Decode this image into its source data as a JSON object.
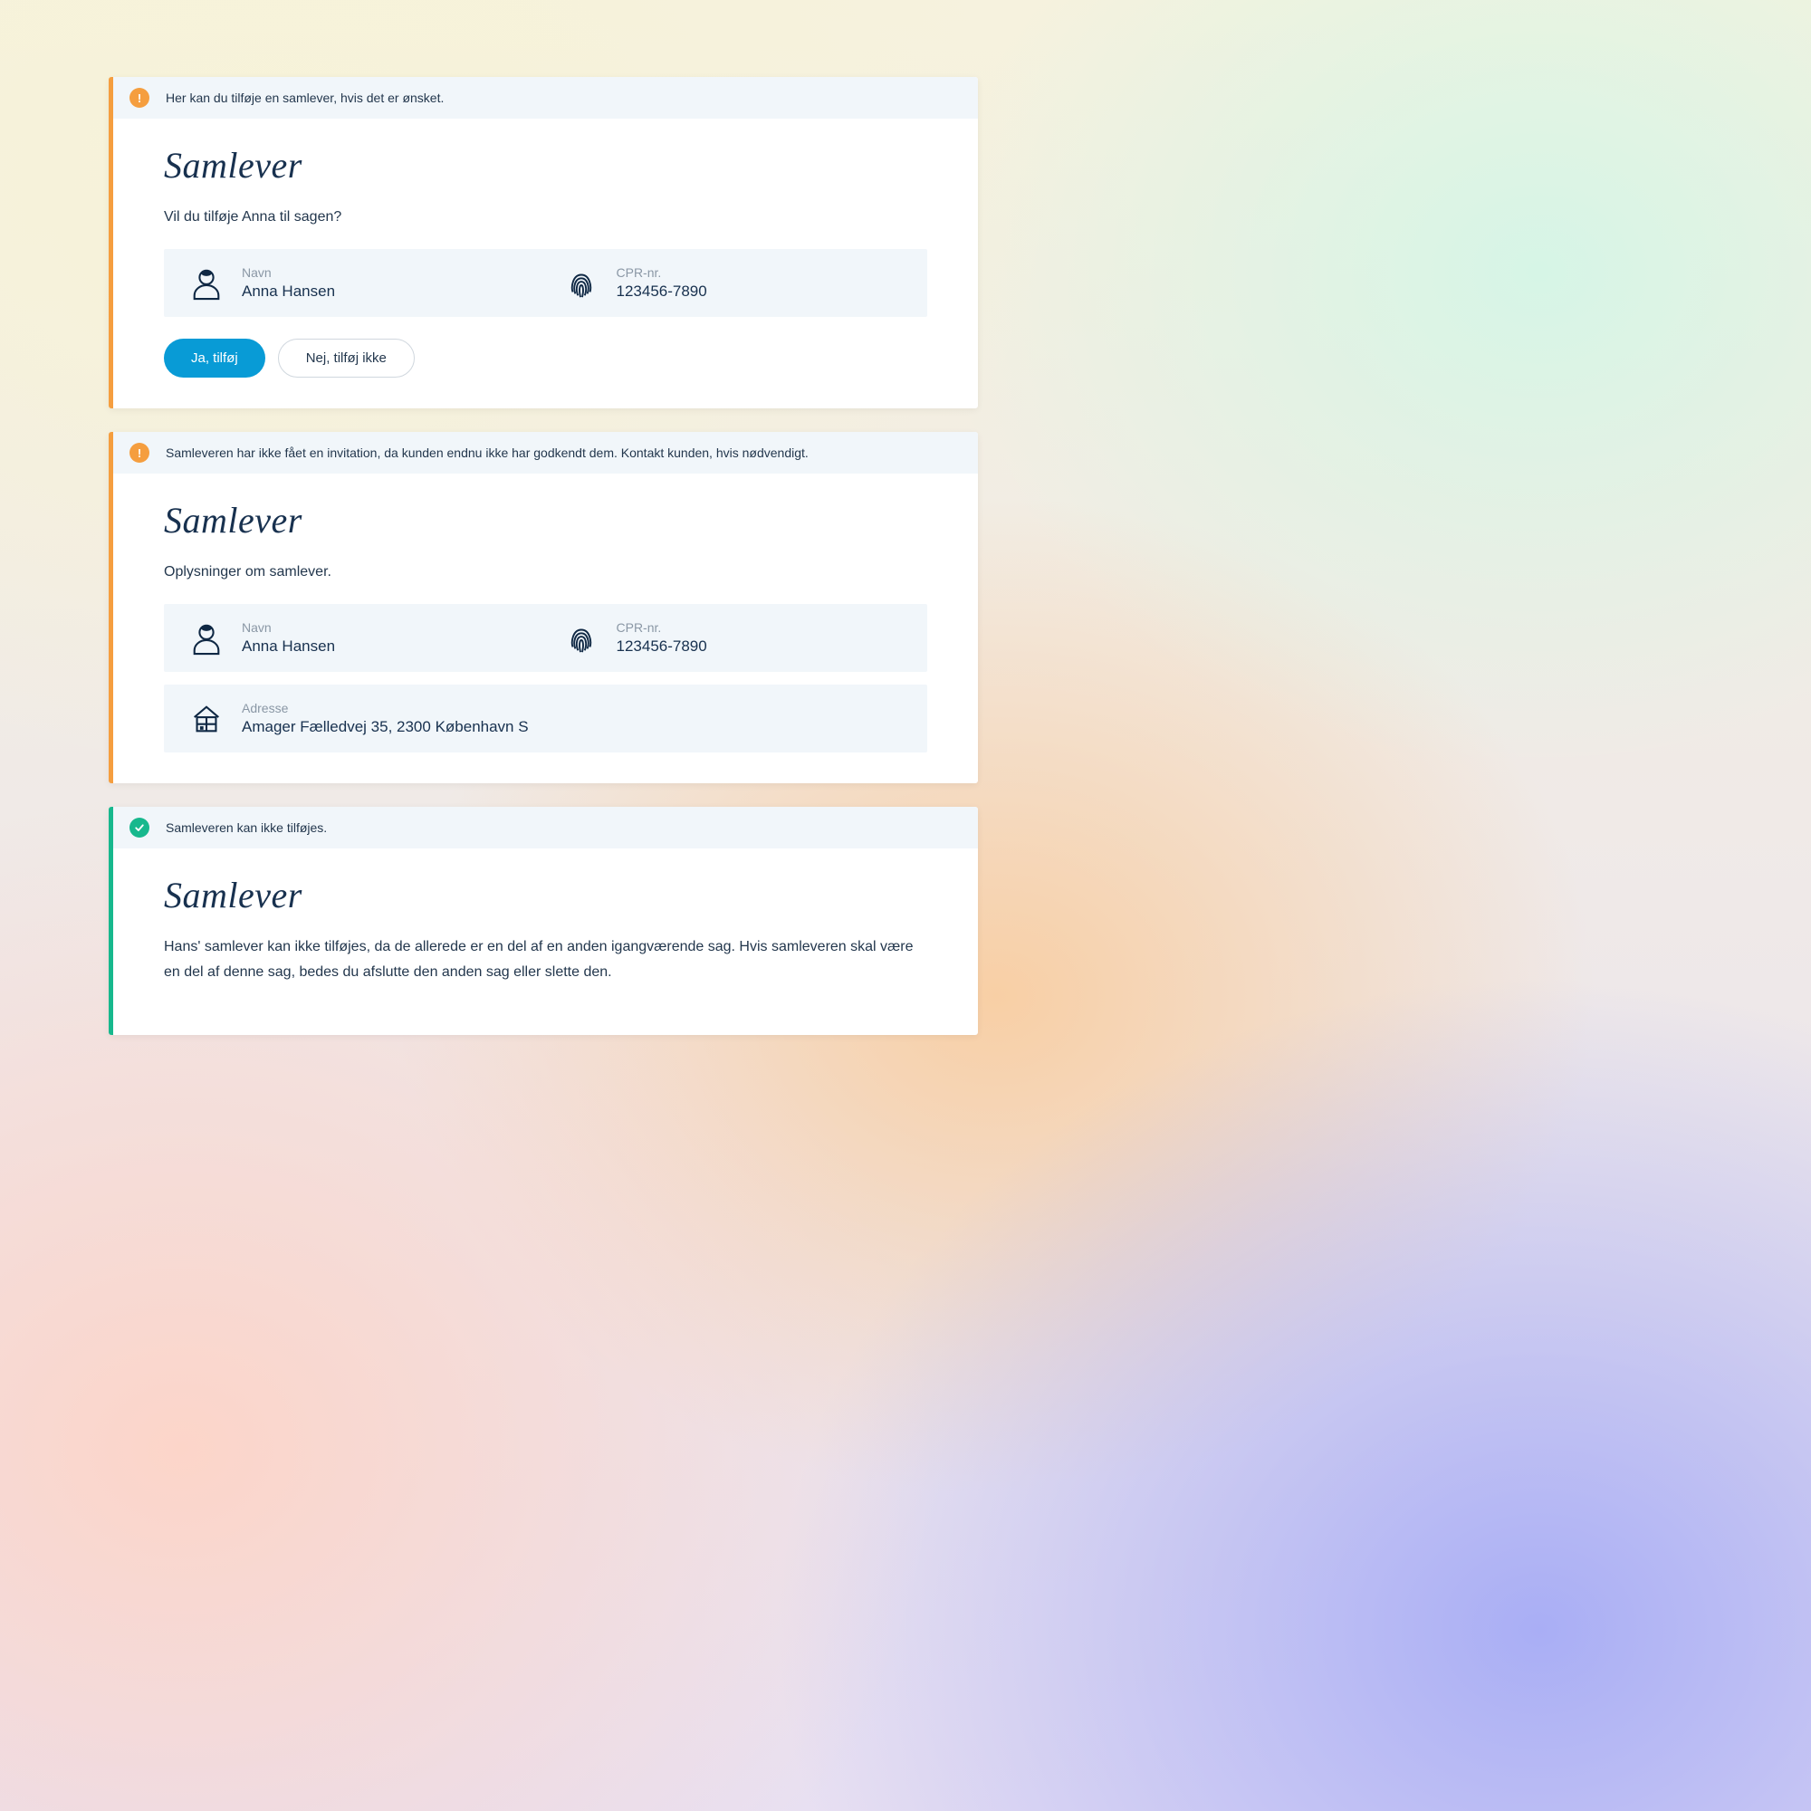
{
  "cards": [
    {
      "accent": "orange",
      "alert_icon": "exclaim",
      "alert_text": "Her kan du tilføje en samlever, hvis det er ønsket.",
      "title": "Samlever",
      "subtitle": "Vil du tilføje Anna til sagen?",
      "info": {
        "name_label": "Navn",
        "name_value": "Anna Hansen",
        "cpr_label": "CPR-nr.",
        "cpr_value": "123456-7890"
      },
      "buttons": {
        "primary": "Ja, tilføj",
        "secondary": "Nej, tilføj ikke"
      }
    },
    {
      "accent": "orange",
      "alert_icon": "exclaim",
      "alert_text": "Samleveren har ikke fået en invitation, da kunden endnu ikke har godkendt dem. Kontakt kunden, hvis nødvendigt.",
      "title": "Samlever",
      "subtitle": "Oplysninger om samlever.",
      "info": {
        "name_label": "Navn",
        "name_value": "Anna Hansen",
        "cpr_label": "CPR-nr.",
        "cpr_value": "123456-7890",
        "address_label": "Adresse",
        "address_value": "Amager Fælledvej 35, 2300 København S"
      }
    },
    {
      "accent": "teal",
      "alert_icon": "check",
      "alert_text": "Samleveren kan ikke tilføjes.",
      "title": "Samlever",
      "subtitle": "Hans' samlever kan ikke tilføjes, da de allerede er en del af en anden igangværende sag. Hvis samleveren skal være en del af denne sag, bedes du afslutte den anden sag eller slette den."
    }
  ]
}
